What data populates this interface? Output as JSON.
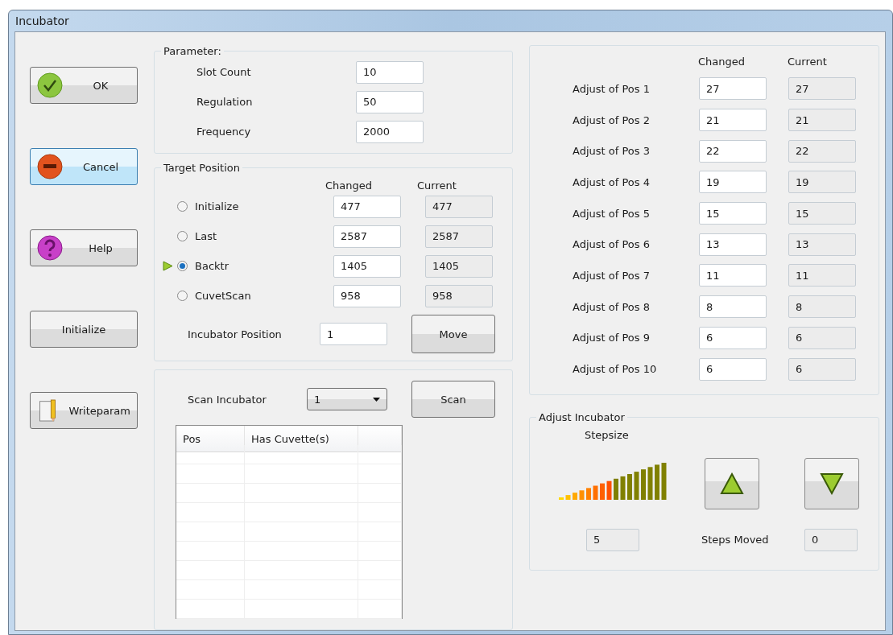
{
  "window": {
    "title": "Incubator"
  },
  "buttons": [
    {
      "label": "OK",
      "kind": "check",
      "focused": false
    },
    {
      "label": "Cancel",
      "kind": "minus",
      "focused": true
    },
    {
      "label": "Help",
      "kind": "question",
      "focused": false
    },
    {
      "label": "Initialize",
      "kind": "plain",
      "focused": false
    },
    {
      "label": "Writeparam",
      "kind": "pencil",
      "focused": false
    }
  ],
  "parameter": {
    "title": "Parameter:",
    "fields": [
      {
        "label": "Slot Count",
        "value": "10"
      },
      {
        "label": "Regulation",
        "value": "50"
      },
      {
        "label": "Frequency",
        "value": "2000"
      }
    ]
  },
  "target_position": {
    "title": "Target Position",
    "columns": [
      "Changed",
      "Current"
    ],
    "rows": [
      {
        "label": "Initialize",
        "selected": false,
        "marker": false,
        "changed": "477",
        "current": "477"
      },
      {
        "label": "Last",
        "selected": false,
        "marker": false,
        "changed": "2587",
        "current": "2587"
      },
      {
        "label": "Backtr",
        "selected": true,
        "marker": true,
        "changed": "1405",
        "current": "1405"
      },
      {
        "label": "CuvetScan",
        "selected": false,
        "marker": false,
        "changed": "958",
        "current": "958"
      }
    ],
    "incubator_position": {
      "label": "Incubator Position",
      "value": "1"
    },
    "move_button": "Move"
  },
  "scan": {
    "label": "Scan Incubator",
    "dropdown": "1",
    "button": "Scan",
    "table": {
      "columns": [
        "Pos",
        "Has Cuvette(s)"
      ]
    }
  },
  "adjust_positions": {
    "columns": [
      "Changed",
      "Current"
    ],
    "rows": [
      {
        "label": "Adjust of Pos 1",
        "changed": "27",
        "current": "27"
      },
      {
        "label": "Adjust of Pos 2",
        "changed": "21",
        "current": "21"
      },
      {
        "label": "Adjust of Pos 3",
        "changed": "22",
        "current": "22"
      },
      {
        "label": "Adjust of Pos 4",
        "changed": "19",
        "current": "19"
      },
      {
        "label": "Adjust of Pos 5",
        "changed": "15",
        "current": "15"
      },
      {
        "label": "Adjust of Pos 6",
        "changed": "13",
        "current": "13"
      },
      {
        "label": "Adjust of Pos 7",
        "changed": "11",
        "current": "11"
      },
      {
        "label": "Adjust of Pos 8",
        "changed": "8",
        "current": "8"
      },
      {
        "label": "Adjust of Pos 9",
        "changed": "6",
        "current": "6"
      },
      {
        "label": "Adjust of Pos 10",
        "changed": "6",
        "current": "6"
      }
    ]
  },
  "adjust_incubator": {
    "title": "Adjust Incubator",
    "stepsize_label": "Stepsize",
    "level": 0.5,
    "stepsize": "5",
    "steps_moved_label": "Steps Moved",
    "steps_moved": "0"
  }
}
